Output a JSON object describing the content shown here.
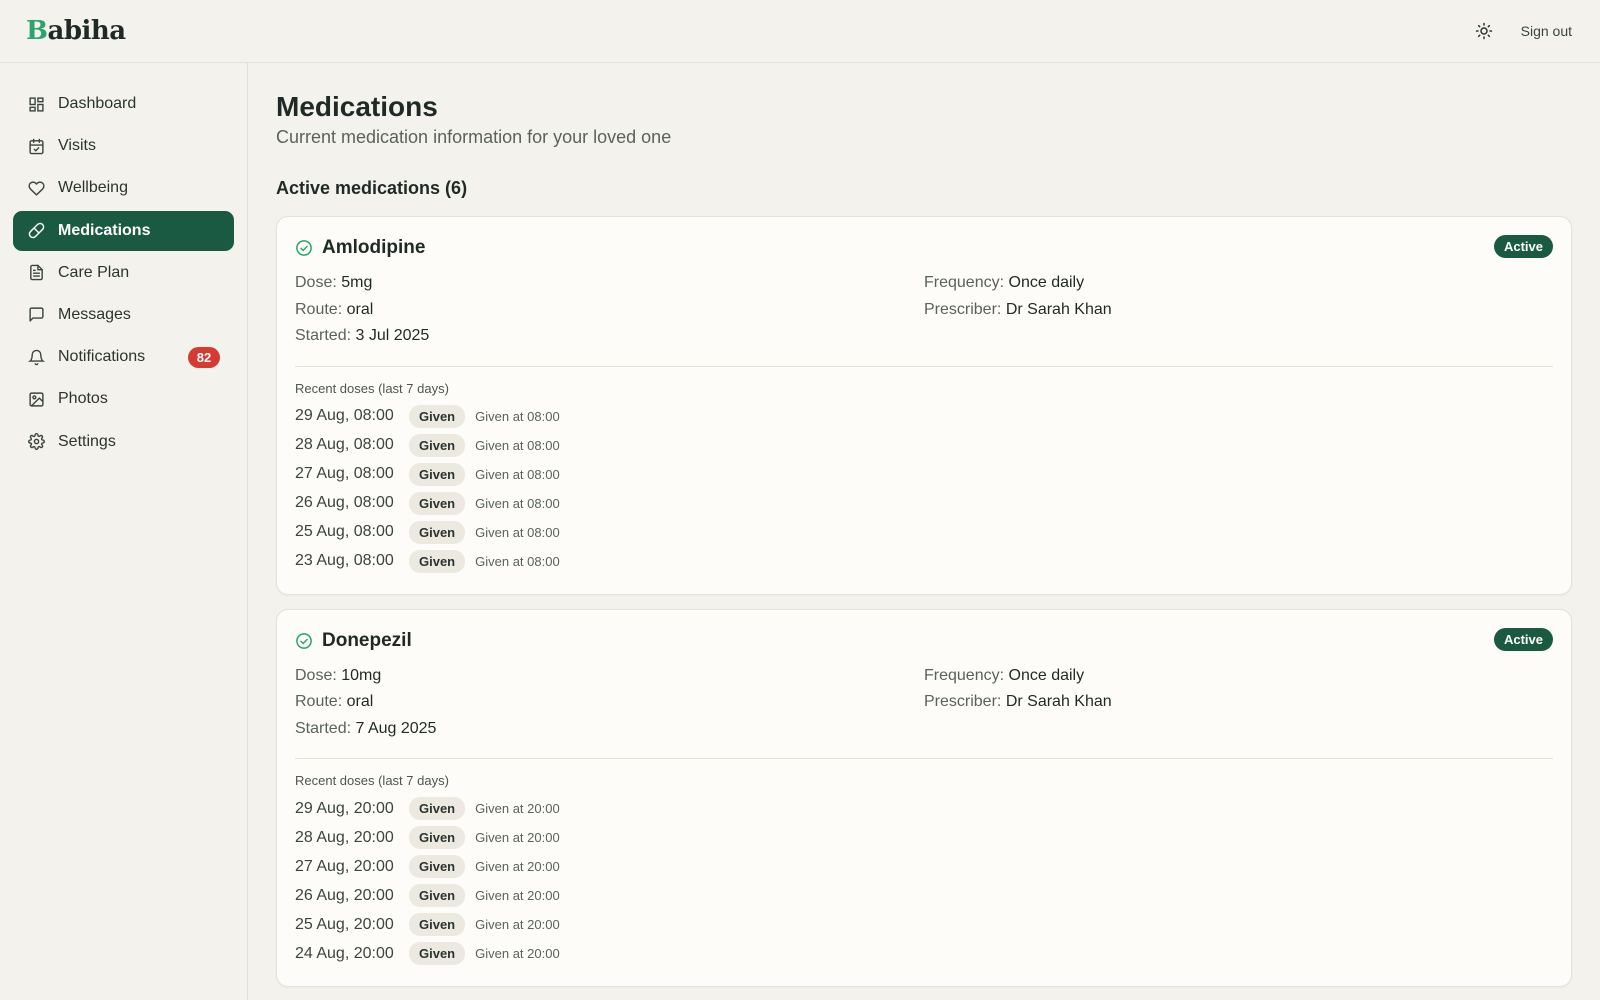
{
  "brand": {
    "first_letter": "B",
    "rest": "abiha"
  },
  "topbar": {
    "signout_label": "Sign out",
    "theme_icon": "sun-icon"
  },
  "sidebar": {
    "items": [
      {
        "label": "Dashboard",
        "icon": "dashboard-icon"
      },
      {
        "label": "Visits",
        "icon": "calendar-icon"
      },
      {
        "label": "Wellbeing",
        "icon": "heart-icon"
      },
      {
        "label": "Medications",
        "icon": "pill-icon",
        "active": true
      },
      {
        "label": "Care Plan",
        "icon": "document-icon"
      },
      {
        "label": "Messages",
        "icon": "message-icon"
      },
      {
        "label": "Notifications",
        "icon": "bell-icon",
        "badge": "82"
      },
      {
        "label": "Photos",
        "icon": "photo-icon"
      },
      {
        "label": "Settings",
        "icon": "gear-icon"
      }
    ]
  },
  "page": {
    "title": "Medications",
    "subtitle": "Current medication information for your loved one",
    "section_title": "Active medications (6)"
  },
  "medications": [
    {
      "name": "Amlodipine",
      "status": "Active",
      "dose_label": "Dose:",
      "dose": "5mg",
      "route_label": "Route:",
      "route": "oral",
      "started_label": "Started:",
      "started": "3 Jul 2025",
      "frequency_label": "Frequency:",
      "frequency": "Once daily",
      "prescriber_label": "Prescriber:",
      "prescriber": "Dr Sarah Khan",
      "doses_title": "Recent doses (last 7 days)",
      "doses": [
        {
          "time": "29 Aug, 08:00",
          "status": "Given",
          "note": "Given at 08:00"
        },
        {
          "time": "28 Aug, 08:00",
          "status": "Given",
          "note": "Given at 08:00"
        },
        {
          "time": "27 Aug, 08:00",
          "status": "Given",
          "note": "Given at 08:00"
        },
        {
          "time": "26 Aug, 08:00",
          "status": "Given",
          "note": "Given at 08:00"
        },
        {
          "time": "25 Aug, 08:00",
          "status": "Given",
          "note": "Given at 08:00"
        },
        {
          "time": "23 Aug, 08:00",
          "status": "Given",
          "note": "Given at 08:00"
        }
      ]
    },
    {
      "name": "Donepezil",
      "status": "Active",
      "dose_label": "Dose:",
      "dose": "10mg",
      "route_label": "Route:",
      "route": "oral",
      "started_label": "Started:",
      "started": "7 Aug 2025",
      "frequency_label": "Frequency:",
      "frequency": "Once daily",
      "prescriber_label": "Prescriber:",
      "prescriber": "Dr Sarah Khan",
      "doses_title": "Recent doses (last 7 days)",
      "doses": [
        {
          "time": "29 Aug, 20:00",
          "status": "Given",
          "note": "Given at 20:00"
        },
        {
          "time": "28 Aug, 20:00",
          "status": "Given",
          "note": "Given at 20:00"
        },
        {
          "time": "27 Aug, 20:00",
          "status": "Given",
          "note": "Given at 20:00"
        },
        {
          "time": "26 Aug, 20:00",
          "status": "Given",
          "note": "Given at 20:00"
        },
        {
          "time": "25 Aug, 20:00",
          "status": "Given",
          "note": "Given at 20:00"
        },
        {
          "time": "24 Aug, 20:00",
          "status": "Given",
          "note": "Given at 20:00"
        }
      ]
    }
  ],
  "colors": {
    "brand_green": "#2ea36f",
    "primary": "#1b5a42",
    "badge_red": "#d63b33",
    "background": "#f4f2ec"
  }
}
